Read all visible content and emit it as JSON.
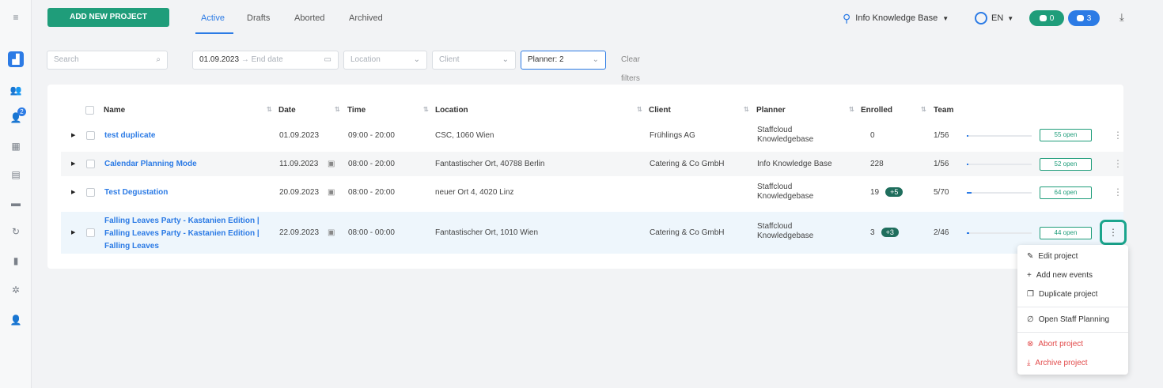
{
  "nav": {
    "add_button": "ADD NEW PROJECT",
    "tabs": [
      "Active",
      "Drafts",
      "Aborted",
      "Archived"
    ],
    "user": "Info Knowledge Base",
    "lang": "EN",
    "chat_count": "0",
    "notif_count": "3",
    "sidebar_badge": "2"
  },
  "filters": {
    "search_placeholder": "Search",
    "start_date": "01.09.2023",
    "end_date_placeholder": "End date",
    "location_placeholder": "Location",
    "client_placeholder": "Client",
    "planner": "Planner: 2",
    "clear": "Clear filters"
  },
  "table": {
    "headers": [
      "Name",
      "Date",
      "Time",
      "Location",
      "Client",
      "Planner",
      "Enrolled",
      "Team"
    ],
    "rows": [
      {
        "name": "test duplicate",
        "date": "01.09.2023",
        "time": "09:00 - 20:00",
        "location": "CSC, 1060 Wien",
        "client": "Frühlings AG",
        "planner": [
          "Staffcloud",
          "Knowledgebase"
        ],
        "enrolled": "0",
        "extra": "",
        "team": "1/56",
        "progress": 0.02,
        "open": "55 open"
      },
      {
        "name": "Calendar Planning Mode",
        "date": "11.09.2023",
        "time": "08:00 - 20:00",
        "location": "Fantastischer Ort, 40788 Berlin",
        "client": "Catering & Co GmbH",
        "planner": [
          "Info Knowledge Base"
        ],
        "enrolled": "228",
        "extra": "",
        "team": "1/56",
        "progress": 0.02,
        "open": "52 open"
      },
      {
        "name": "Test Degustation",
        "date": "20.09.2023",
        "time": "08:00 - 20:00",
        "location": "neuer Ort 4, 4020 Linz",
        "client": "",
        "planner": [
          "Staffcloud",
          "Knowledgebase"
        ],
        "enrolled": "19",
        "extra": "+5",
        "team": "5/70",
        "progress": 0.07,
        "open": "64 open"
      },
      {
        "name_lines": [
          "Falling Leaves Party - Kastanien Edition |",
          "Falling Leaves Party - Kastanien Edition |",
          "Falling Leaves"
        ],
        "date": "22.09.2023",
        "time": "08:00 - 00:00",
        "location": "Fantastischer Ort, 1010 Wien",
        "client": "Catering & Co GmbH",
        "planner": [
          "Staffcloud",
          "Knowledgebase"
        ],
        "enrolled": "3",
        "extra": "+3",
        "team": "2/46",
        "progress": 0.04,
        "open": "44 open"
      }
    ]
  },
  "menu": {
    "items": [
      "Edit project",
      "Add new events",
      "Duplicate project",
      "Open Staff Planning",
      "Abort project",
      "Archive project"
    ]
  },
  "colors": {
    "accent": "#2c7be5",
    "primary_green": "#1f9d7a",
    "danger": "#e24b4b"
  }
}
